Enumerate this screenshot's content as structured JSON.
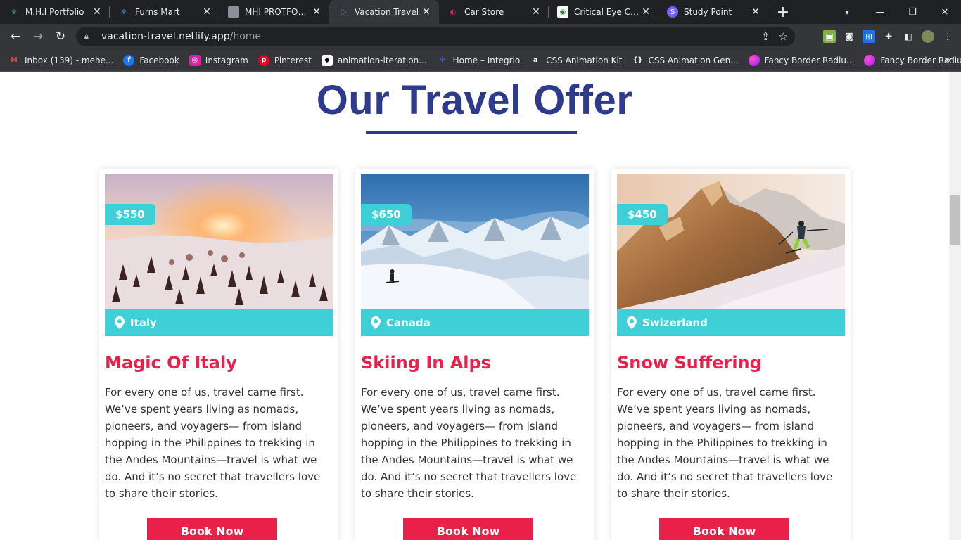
{
  "browser": {
    "tabs": [
      {
        "title": "M.H.I Portfolio",
        "icon": "react-icon",
        "active": false
      },
      {
        "title": "Furns Mart",
        "icon": "react-icon",
        "active": false
      },
      {
        "title": "MHI PROTFOLIO",
        "icon": "avatar-icon",
        "active": false
      },
      {
        "title": "Vacation Travel",
        "icon": "loading-icon",
        "active": true
      },
      {
        "title": "Car Store",
        "icon": "car-icon",
        "active": false
      },
      {
        "title": "Critical Eye Care",
        "icon": "eye-care-icon",
        "active": false
      },
      {
        "title": "Study Point",
        "icon": "study-point-icon",
        "active": false
      }
    ],
    "url": {
      "host": "vacation-travel.netlify.app",
      "path": "/home"
    },
    "bookmarks": [
      {
        "label": "Inbox (139) - mehe...",
        "icon": "gmail-icon"
      },
      {
        "label": "Facebook",
        "icon": "facebook-icon"
      },
      {
        "label": "Instagram",
        "icon": "instagram-icon"
      },
      {
        "label": "Pinterest",
        "icon": "pinterest-icon"
      },
      {
        "label": "animation-iteration...",
        "icon": "codepen-icon"
      },
      {
        "label": "Home – Integrio",
        "icon": "integrio-icon"
      },
      {
        "label": "CSS Animation Kit",
        "icon": "css-kit-icon"
      },
      {
        "label": "CSS Animation Gen...",
        "icon": "braces-icon"
      },
      {
        "label": "Fancy Border Radiu...",
        "icon": "blob-icon"
      },
      {
        "label": "Fancy Border Radiu...",
        "icon": "blob-icon"
      }
    ]
  },
  "page": {
    "heading": "Our Travel Offer",
    "colors": {
      "primary": "#2e3a8c",
      "accent": "#e8204a",
      "teal": "#3fcfd6"
    },
    "cards": [
      {
        "price": "$550",
        "location": "Italy",
        "title": "Magic Of Italy",
        "text": "For every one of us, travel came first. We’ve spent years living as nomads, pioneers, and voyagers— from island hopping in the Philippines to trekking in the Andes Mountains—travel is what we do. And it’s no secret that travellers love to share their stories.",
        "button": "Book Now",
        "image": "snowy-forest-sunset"
      },
      {
        "price": "$650",
        "location": "Canada",
        "title": "Skiing In Alps",
        "text": "For every one of us, travel came first. We’ve spent years living as nomads, pioneers, and voyagers— from island hopping in the Philippines to trekking in the Andes Mountains—travel is what we do. And it’s no secret that travellers love to share their stories.",
        "button": "Book Now",
        "image": "snowy-mountains-skier"
      },
      {
        "price": "$450",
        "location": "Swizerland",
        "title": "Snow Suffering",
        "text": "For every one of us, travel came first. We’ve spent years living as nomads, pioneers, and voyagers— from island hopping in the Philippines to trekking in the Andes Mountains—travel is what we do. And it’s no secret that travellers love to share their stories.",
        "button": "Book Now",
        "image": "rocky-peak-skier"
      }
    ]
  }
}
